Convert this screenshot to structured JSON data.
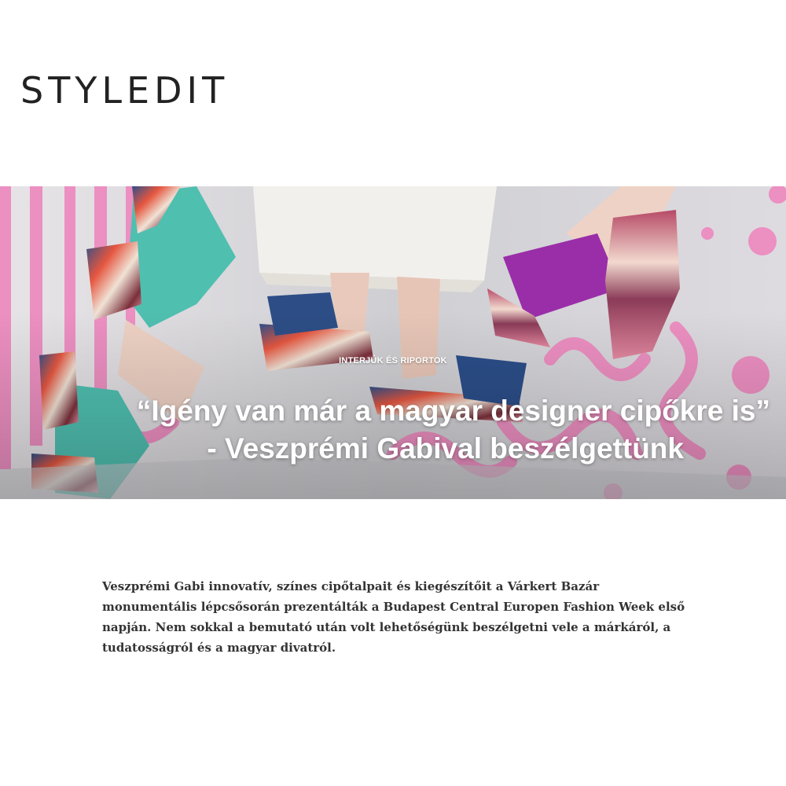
{
  "header": {
    "logo_text": "STYLEDIT"
  },
  "hero": {
    "category": "INTERJÚK ÉS RIPORTOK",
    "title_line1": "“Igény van már a magyar designer cipőkre is”",
    "title_line2": "- Veszprémi Gabival beszélgettünk",
    "image_label": "hero-photo-shoes"
  },
  "article": {
    "lead": "Veszprémi Gabi innovatív, színes cipőtalpait és kiegészítőit a Várkert Bazár monumentális lépcsősorán prezentálták a Budapest Central Europen Fashion Week első napján. Nem sokkal a bemutató után volt lehetőségünk beszélgetni vele a márkáról, a tudatosságról és a magyar divatról."
  },
  "colors": {
    "accent_pink": "#ec8fc1",
    "turquoise": "#4fbfb0",
    "purple": "#9a2ea8",
    "text": "#333333"
  }
}
